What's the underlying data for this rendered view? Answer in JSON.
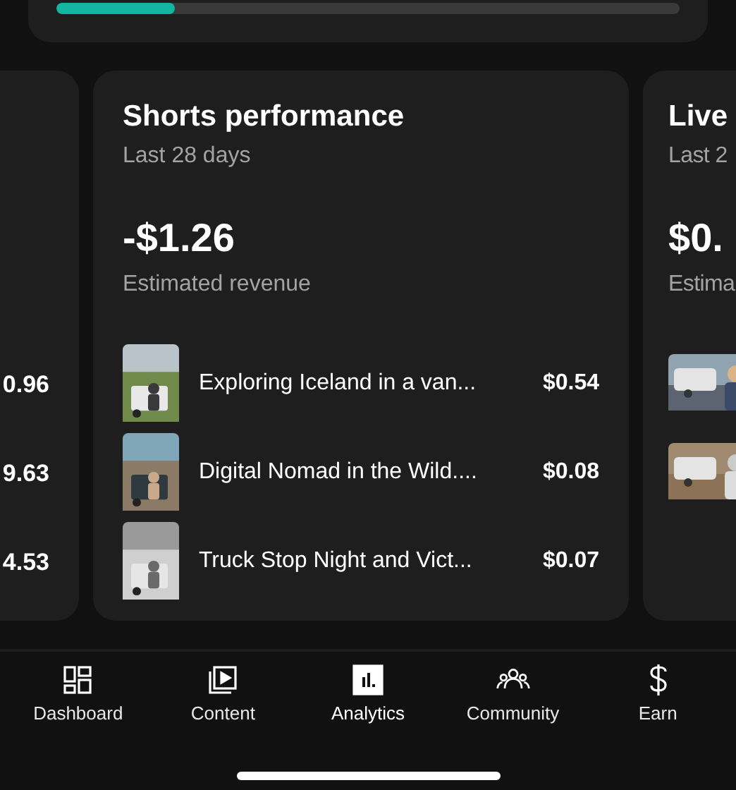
{
  "progress": {
    "level": 0.19
  },
  "left_card": {
    "values": [
      "0.96",
      "9.63",
      "4.53"
    ]
  },
  "shorts_card": {
    "title": "Shorts performance",
    "subtitle": "Last 28 days",
    "amount": "-$1.26",
    "amount_label": "Estimated revenue",
    "videos": [
      {
        "title": "Exploring Iceland in a van...",
        "revenue": "$0.54"
      },
      {
        "title": "Digital Nomad in the Wild....",
        "revenue": "$0.08"
      },
      {
        "title": "Truck Stop Night and Vict...",
        "revenue": "$0.07"
      }
    ]
  },
  "live_card": {
    "title": "Live",
    "subtitle": "Last 2",
    "amount": "$0.",
    "amount_label": "Estima"
  },
  "tabs": [
    {
      "label": "Dashboard",
      "selected": false
    },
    {
      "label": "Content",
      "selected": false
    },
    {
      "label": "Analytics",
      "selected": true
    },
    {
      "label": "Community",
      "selected": false
    },
    {
      "label": "Earn",
      "selected": false
    }
  ]
}
